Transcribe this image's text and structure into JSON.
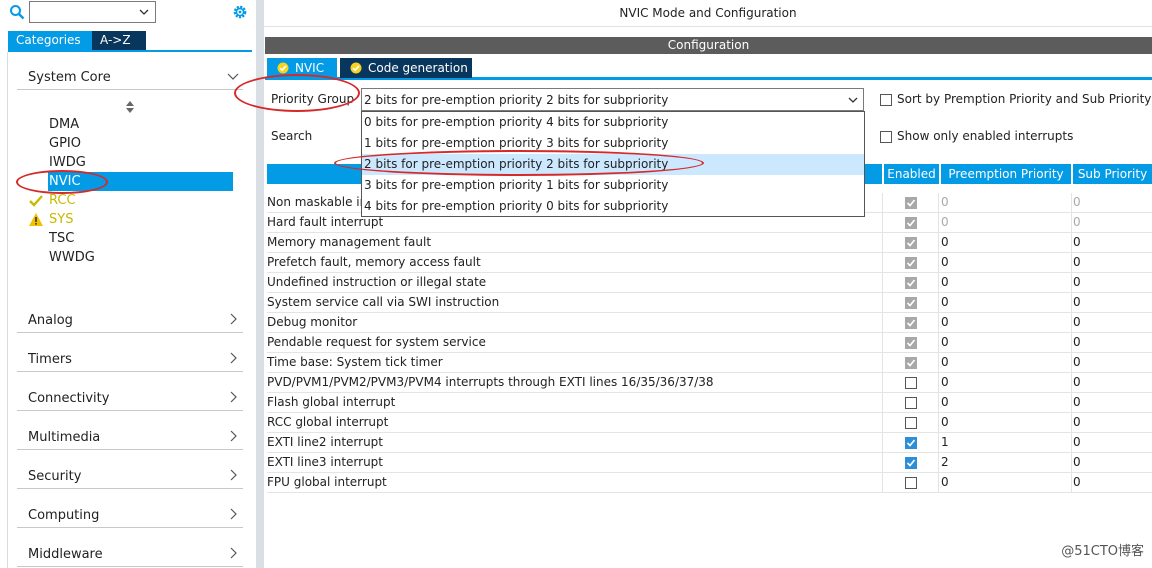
{
  "sidebar": {
    "search_value": "",
    "tabs": [
      {
        "label": "Categories",
        "active": true
      },
      {
        "label": "A->Z",
        "active": false
      }
    ],
    "categories": [
      {
        "label": "System Core",
        "expanded": true
      },
      {
        "label": "Analog"
      },
      {
        "label": "Timers"
      },
      {
        "label": "Connectivity"
      },
      {
        "label": "Multimedia"
      },
      {
        "label": "Security"
      },
      {
        "label": "Computing"
      },
      {
        "label": "Middleware"
      }
    ],
    "peripherals": [
      {
        "label": "DMA",
        "status": "none"
      },
      {
        "label": "GPIO",
        "status": "none"
      },
      {
        "label": "IWDG",
        "status": "none"
      },
      {
        "label": "NVIC",
        "status": "selected"
      },
      {
        "label": "RCC",
        "status": "ok"
      },
      {
        "label": "SYS",
        "status": "warning"
      },
      {
        "label": "TSC",
        "status": "none"
      },
      {
        "label": "WWDG",
        "status": "none"
      }
    ]
  },
  "main": {
    "mode_title": "NVIC Mode and Configuration",
    "config_title": "Configuration",
    "subtabs": [
      {
        "label": "NVIC"
      },
      {
        "label": "Code generation"
      }
    ],
    "priority_group": {
      "label": "Priority Group",
      "value": "2 bits for pre-emption priority 2 bits for subpriority",
      "options": [
        "0 bits for pre-emption priority 4 bits for subpriority",
        "1 bits for pre-emption priority 3 bits for subpriority",
        "2 bits for pre-emption priority 2 bits for subpriority",
        "3 bits for pre-emption priority 1 bits for subpriority",
        "4 bits for pre-emption priority 0 bits for subpriority"
      ],
      "highlighted_option": 2
    },
    "search_label": "Search",
    "sort_option": {
      "label": "Sort by Premption Priority and Sub Priority",
      "checked": false
    },
    "enabled_only_option": {
      "label": "Show only enabled interrupts",
      "checked": false
    },
    "table": {
      "headers": {
        "name": "",
        "enabled": "Enabled",
        "preemption": "Preemption Priority",
        "sub": "Sub Priority"
      },
      "rows": [
        {
          "name": "Non maskable in",
          "enabled": true,
          "locked": true,
          "preemption": "0",
          "sub": "0",
          "dim": true
        },
        {
          "name": "Hard fault interrupt",
          "enabled": true,
          "locked": true,
          "preemption": "0",
          "sub": "0",
          "dim": true
        },
        {
          "name": "Memory management fault",
          "enabled": true,
          "locked": true,
          "preemption": "0",
          "sub": "0"
        },
        {
          "name": "Prefetch fault, memory access fault",
          "enabled": true,
          "locked": true,
          "preemption": "0",
          "sub": "0"
        },
        {
          "name": "Undefined instruction or illegal state",
          "enabled": true,
          "locked": true,
          "preemption": "0",
          "sub": "0"
        },
        {
          "name": "System service call via SWI instruction",
          "enabled": true,
          "locked": true,
          "preemption": "0",
          "sub": "0"
        },
        {
          "name": "Debug monitor",
          "enabled": true,
          "locked": true,
          "preemption": "0",
          "sub": "0"
        },
        {
          "name": "Pendable request for system service",
          "enabled": true,
          "locked": true,
          "preemption": "0",
          "sub": "0"
        },
        {
          "name": "Time base: System tick timer",
          "enabled": true,
          "locked": true,
          "preemption": "0",
          "sub": "0"
        },
        {
          "name": "PVD/PVM1/PVM2/PVM3/PVM4 interrupts through EXTI lines 16/35/36/37/38",
          "enabled": false,
          "locked": false,
          "preemption": "0",
          "sub": "0"
        },
        {
          "name": "Flash global interrupt",
          "enabled": false,
          "locked": false,
          "preemption": "0",
          "sub": "0"
        },
        {
          "name": "RCC global interrupt",
          "enabled": false,
          "locked": false,
          "preemption": "0",
          "sub": "0"
        },
        {
          "name": "EXTI line2 interrupt",
          "enabled": true,
          "locked": false,
          "preemption": "1",
          "sub": "0"
        },
        {
          "name": "EXTI line3 interrupt",
          "enabled": true,
          "locked": false,
          "preemption": "2",
          "sub": "0"
        },
        {
          "name": "FPU global interrupt",
          "enabled": false,
          "locked": false,
          "preemption": "0",
          "sub": "0"
        }
      ]
    }
  },
  "watermark": "@51CTO博客",
  "colors": {
    "accent": "#039be5",
    "dark_tab": "#08365c",
    "annotation": "#d42a2a",
    "warning": "#c9b800"
  }
}
